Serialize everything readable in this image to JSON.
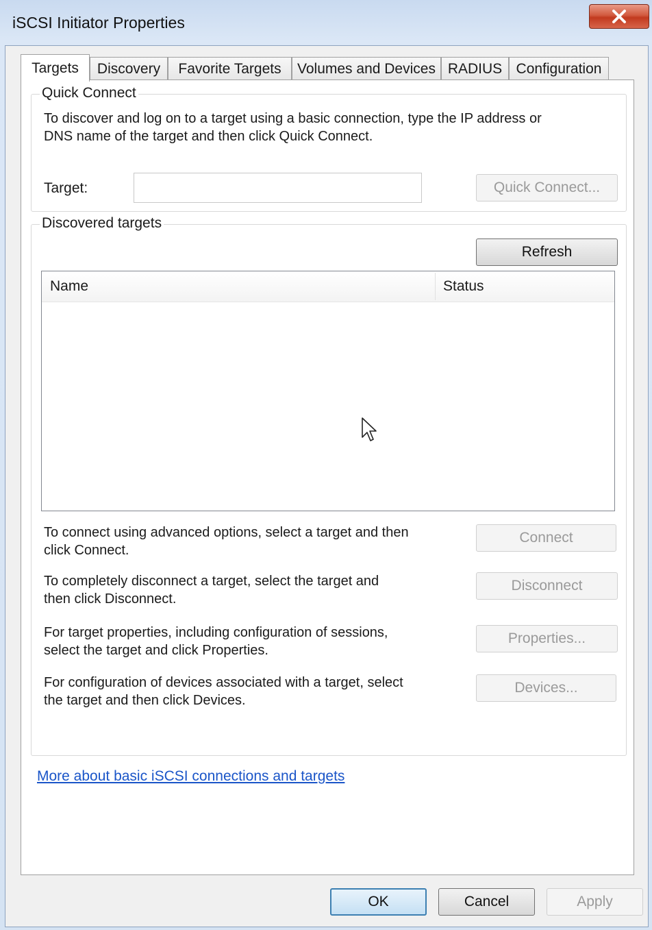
{
  "window": {
    "title": "iSCSI Initiator Properties"
  },
  "tabs": [
    {
      "label": "Targets",
      "active": true
    },
    {
      "label": "Discovery"
    },
    {
      "label": "Favorite Targets"
    },
    {
      "label": "Volumes and Devices"
    },
    {
      "label": "RADIUS"
    },
    {
      "label": "Configuration"
    }
  ],
  "quick_connect": {
    "legend": "Quick Connect",
    "description_line1": "To discover and log on to a target using a basic connection, type the IP address or",
    "description_line2": "DNS name of the target and then click Quick Connect.",
    "target_label": "Target:",
    "target_value": "",
    "quick_connect_button": "Quick Connect..."
  },
  "discovered_targets": {
    "legend": "Discovered targets",
    "refresh_button": "Refresh",
    "columns": [
      "Name",
      "Status"
    ],
    "rows": [],
    "connect_text_1": "To connect using advanced options, select a target and then",
    "connect_text_2": "click Connect.",
    "connect_button": "Connect",
    "disconnect_text_1": "To completely disconnect a target, select the target and",
    "disconnect_text_2": "then click Disconnect.",
    "disconnect_button": "Disconnect",
    "properties_text_1": "For target properties, including configuration of sessions,",
    "properties_text_2": "select the target and click Properties.",
    "properties_button": "Properties...",
    "devices_text_1": "For configuration of devices associated with a target, select",
    "devices_text_2": "the target and then click Devices.",
    "devices_button": "Devices..."
  },
  "help_link": "More about basic iSCSI connections and targets",
  "footer": {
    "ok_button": "OK",
    "cancel_button": "Cancel",
    "apply_button": "Apply"
  },
  "colors": {
    "link": "#1a55c8",
    "close_button": "#c8442a",
    "disabled_text": "#9a9a9a"
  }
}
